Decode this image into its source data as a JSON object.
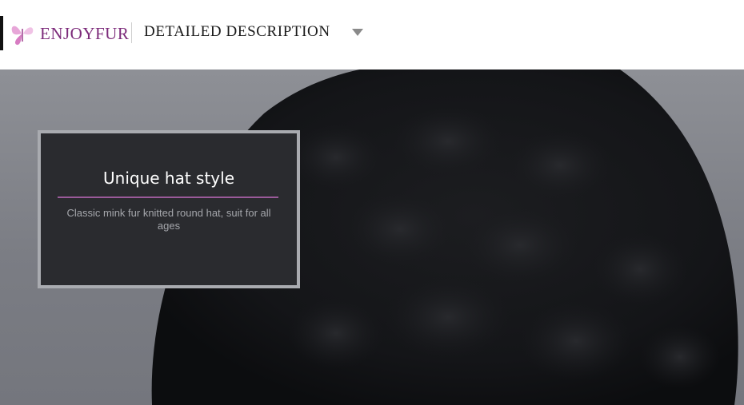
{
  "brand": {
    "name": "ENJOYFUR",
    "logo_icon": "butterfly-icon",
    "accent_color": "#7c2a7a"
  },
  "header": {
    "section_title": "DETAILED DESCRIPTION",
    "dropdown_icon": "triangle-down-icon"
  },
  "feature": {
    "title": "Unique hat style",
    "description": "Classic mink fur knitted round hat, suit for all ages",
    "rule_color": "#9a5a9a"
  },
  "hero": {
    "image_subject": "black-mink-fur-hat"
  }
}
